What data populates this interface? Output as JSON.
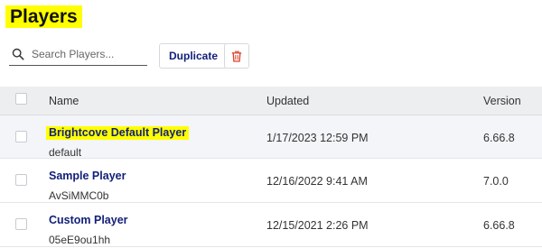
{
  "page": {
    "title": "Players"
  },
  "toolbar": {
    "search_placeholder": "Search Players...",
    "duplicate_label": "Duplicate"
  },
  "table": {
    "headers": {
      "name": "Name",
      "updated": "Updated",
      "version": "Version"
    },
    "rows": [
      {
        "name": "Brightcove Default Player",
        "id": "default",
        "updated": "1/17/2023 12:59 PM",
        "version": "6.66.8"
      },
      {
        "name": "Sample Player",
        "id": "AvSiMMC0b",
        "updated": "12/16/2022 9:41 AM",
        "version": "7.0.0"
      },
      {
        "name": "Custom Player",
        "id": "05eE9ou1hh",
        "updated": "12/15/2021 2:26 PM",
        "version": "6.66.8"
      }
    ]
  },
  "colors": {
    "link": "#13207a",
    "highlight": "#ffff00",
    "delete_icon": "#d9412a",
    "header_bg": "#edeef0"
  },
  "icons": {
    "search": "search-icon",
    "delete": "trash-icon"
  }
}
